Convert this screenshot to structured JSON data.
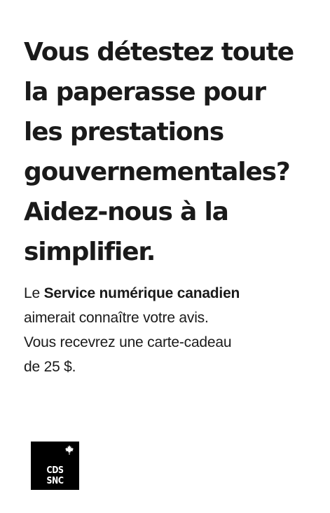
{
  "headline": {
    "lines": [
      "Vous détestez toute",
      "la paperasse pour",
      "les prestations",
      "gouvernementales?",
      "Aidez-nous à la",
      "simplifier."
    ]
  },
  "body": {
    "prefix": "Le ",
    "organization": "Service numérique canadien",
    "line2": "aimerait connaître votre avis.",
    "line3": "Vous recevrez une carte-cadeau",
    "line4": "de 25 $."
  },
  "logo": {
    "line1": "CDS",
    "line2": "SNC",
    "icon": "maple-leaf-icon",
    "background": "#000000",
    "foreground": "#ffffff"
  },
  "colors": {
    "text": "#1a1a1a",
    "background": "#ffffff"
  }
}
